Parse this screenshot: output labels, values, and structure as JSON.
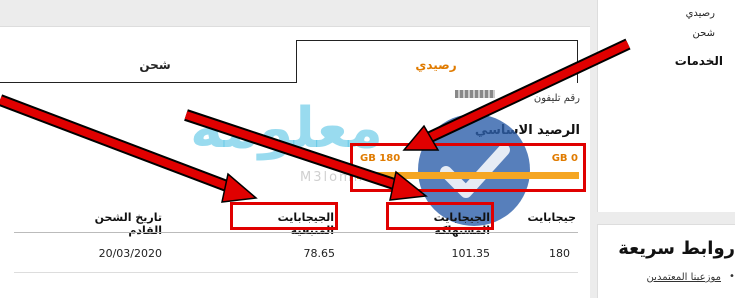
{
  "tabs": {
    "balance_label": "رصيدي",
    "recharge_label": "شحن"
  },
  "account": {
    "phone_label": "رقم تليفون",
    "basic_balance_label": "الرصيد الاساسي"
  },
  "usage_bar": {
    "left_label": "GB 180",
    "right_label": "GB 0",
    "fill_fraction": 1.0,
    "fill_color": "#f5a623"
  },
  "table": {
    "headers": {
      "gigs": "جيجابايت",
      "consumed": "الجيجابايت المستهلكة",
      "remaining": "الجيجابايت المتبقية",
      "next_recharge_date": "تاريخ الشحن القادم"
    },
    "row": {
      "gigs": "180",
      "consumed": "101.35",
      "remaining": "78.65",
      "next_recharge_date": "20/03/2020"
    }
  },
  "sidebar": {
    "items": [
      {
        "label": "رصيدي"
      },
      {
        "label": "شحن"
      },
      {
        "label": "الخدمات"
      }
    ]
  },
  "quick_links": {
    "title": "روابط سريعة",
    "items": [
      {
        "label": "موزعينا المعتمدين"
      }
    ]
  },
  "watermark": {
    "text": "معلومة",
    "sub": "M3lomh.com"
  },
  "colors": {
    "accent": "#e07b00",
    "annotation": "#e00000"
  }
}
